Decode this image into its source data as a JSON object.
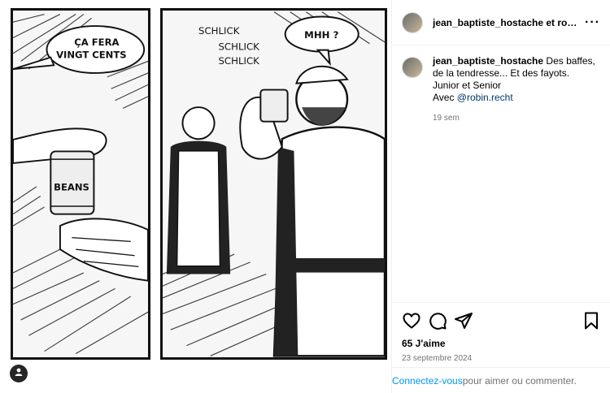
{
  "header": {
    "username": "jean_baptiste_hostache et robin.",
    "more_icon": "more-horizontal-icon"
  },
  "caption": {
    "username": "jean_baptiste_hostache",
    "line1": "Des baffes,",
    "line2": "de la tendresse... Et des fayots.",
    "line3": "Junior et Senior",
    "line4_prefix": "Avec ",
    "mention": "@robin.recht",
    "time": "19 sem"
  },
  "comic": {
    "bubble1_line1": "ÇA FERA",
    "bubble1_line2": "VINGT CENTS",
    "can_label": "BEANS",
    "sfx1": "SCHLICK",
    "sfx2": "SCHLICK",
    "sfx3": "SCHLICK",
    "bubble2": "MHH ?"
  },
  "actions": {
    "like_icon": "heart-icon",
    "comment_icon": "comment-icon",
    "share_icon": "share-icon",
    "save_icon": "bookmark-icon",
    "likes": "65 J'aime",
    "date": "23 septembre 2024"
  },
  "login": {
    "link": "Connectez-vous",
    "rest": " pour aimer ou commenter."
  },
  "tag_icon": "user-tag-icon"
}
